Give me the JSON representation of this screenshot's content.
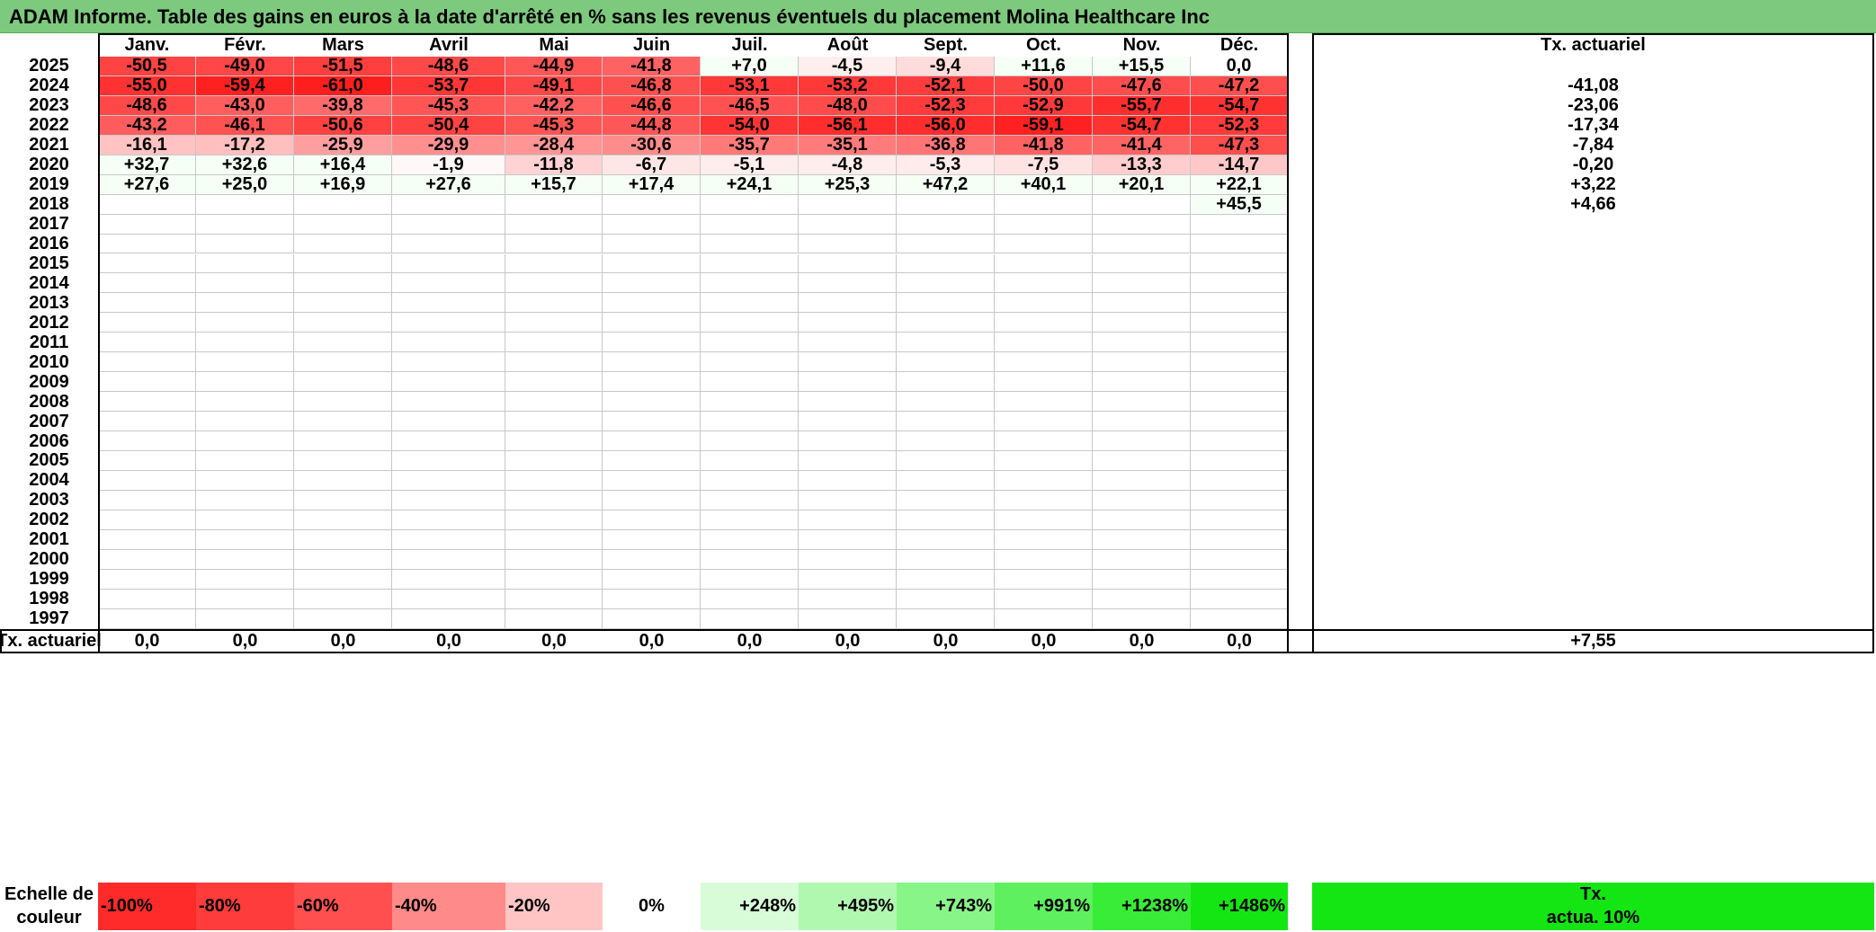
{
  "title": "ADAM Informe. Table des gains en euros à la date d'arrêté en % sans les revenus éventuels du placement Molina Healthcare Inc",
  "months": [
    "Janv.",
    "Févr.",
    "Mars",
    "Avril",
    "Mai",
    "Juin",
    "Juil.",
    "Août",
    "Sept.",
    "Oct.",
    "Nov.",
    "Déc."
  ],
  "annual_header": "Tx. actuariel",
  "rows": [
    {
      "year": "2025",
      "values": [
        "-50,5",
        "-49,0",
        "-51,5",
        "-48,6",
        "-44,9",
        "-41,8",
        "+7,0",
        "-4,5",
        "-9,4",
        "+11,6",
        "+15,5",
        "0,0"
      ],
      "annual": ""
    },
    {
      "year": "2024",
      "values": [
        "-55,0",
        "-59,4",
        "-61,0",
        "-53,7",
        "-49,1",
        "-46,8",
        "-53,1",
        "-53,2",
        "-52,1",
        "-50,0",
        "-47,6",
        "-47,2"
      ],
      "annual": "-41,08"
    },
    {
      "year": "2023",
      "values": [
        "-48,6",
        "-43,0",
        "-39,8",
        "-45,3",
        "-42,2",
        "-46,6",
        "-46,5",
        "-48,0",
        "-52,3",
        "-52,9",
        "-55,7",
        "-54,7"
      ],
      "annual": "-23,06"
    },
    {
      "year": "2022",
      "values": [
        "-43,2",
        "-46,1",
        "-50,6",
        "-50,4",
        "-45,3",
        "-44,8",
        "-54,0",
        "-56,1",
        "-56,0",
        "-59,1",
        "-54,7",
        "-52,3"
      ],
      "annual": "-17,34"
    },
    {
      "year": "2021",
      "values": [
        "-16,1",
        "-17,2",
        "-25,9",
        "-29,9",
        "-28,4",
        "-30,6",
        "-35,7",
        "-35,1",
        "-36,8",
        "-41,8",
        "-41,4",
        "-47,3"
      ],
      "annual": "-7,84"
    },
    {
      "year": "2020",
      "values": [
        "+32,7",
        "+32,6",
        "+16,4",
        "-1,9",
        "-11,8",
        "-6,7",
        "-5,1",
        "-4,8",
        "-5,3",
        "-7,5",
        "-13,3",
        "-14,7"
      ],
      "annual": "-0,20"
    },
    {
      "year": "2019",
      "values": [
        "+27,6",
        "+25,0",
        "+16,9",
        "+27,6",
        "+15,7",
        "+17,4",
        "+24,1",
        "+25,3",
        "+47,2",
        "+40,1",
        "+20,1",
        "+22,1"
      ],
      "annual": "+3,22"
    },
    {
      "year": "2018",
      "values": [
        "",
        "",
        "",
        "",
        "",
        "",
        "",
        "",
        "",
        "",
        "",
        "+45,5"
      ],
      "annual": "+4,66"
    },
    {
      "year": "2017",
      "values": [
        "",
        "",
        "",
        "",
        "",
        "",
        "",
        "",
        "",
        "",
        "",
        ""
      ],
      "annual": ""
    },
    {
      "year": "2016",
      "values": [
        "",
        "",
        "",
        "",
        "",
        "",
        "",
        "",
        "",
        "",
        "",
        ""
      ],
      "annual": ""
    },
    {
      "year": "2015",
      "values": [
        "",
        "",
        "",
        "",
        "",
        "",
        "",
        "",
        "",
        "",
        "",
        ""
      ],
      "annual": ""
    },
    {
      "year": "2014",
      "values": [
        "",
        "",
        "",
        "",
        "",
        "",
        "",
        "",
        "",
        "",
        "",
        ""
      ],
      "annual": ""
    },
    {
      "year": "2013",
      "values": [
        "",
        "",
        "",
        "",
        "",
        "",
        "",
        "",
        "",
        "",
        "",
        ""
      ],
      "annual": ""
    },
    {
      "year": "2012",
      "values": [
        "",
        "",
        "",
        "",
        "",
        "",
        "",
        "",
        "",
        "",
        "",
        ""
      ],
      "annual": ""
    },
    {
      "year": "2011",
      "values": [
        "",
        "",
        "",
        "",
        "",
        "",
        "",
        "",
        "",
        "",
        "",
        ""
      ],
      "annual": ""
    },
    {
      "year": "2010",
      "values": [
        "",
        "",
        "",
        "",
        "",
        "",
        "",
        "",
        "",
        "",
        "",
        ""
      ],
      "annual": ""
    },
    {
      "year": "2009",
      "values": [
        "",
        "",
        "",
        "",
        "",
        "",
        "",
        "",
        "",
        "",
        "",
        ""
      ],
      "annual": ""
    },
    {
      "year": "2008",
      "values": [
        "",
        "",
        "",
        "",
        "",
        "",
        "",
        "",
        "",
        "",
        "",
        ""
      ],
      "annual": ""
    },
    {
      "year": "2007",
      "values": [
        "",
        "",
        "",
        "",
        "",
        "",
        "",
        "",
        "",
        "",
        "",
        ""
      ],
      "annual": ""
    },
    {
      "year": "2006",
      "values": [
        "",
        "",
        "",
        "",
        "",
        "",
        "",
        "",
        "",
        "",
        "",
        ""
      ],
      "annual": ""
    },
    {
      "year": "2005",
      "values": [
        "",
        "",
        "",
        "",
        "",
        "",
        "",
        "",
        "",
        "",
        "",
        ""
      ],
      "annual": ""
    },
    {
      "year": "2004",
      "values": [
        "",
        "",
        "",
        "",
        "",
        "",
        "",
        "",
        "",
        "",
        "",
        ""
      ],
      "annual": ""
    },
    {
      "year": "2003",
      "values": [
        "",
        "",
        "",
        "",
        "",
        "",
        "",
        "",
        "",
        "",
        "",
        ""
      ],
      "annual": ""
    },
    {
      "year": "2002",
      "values": [
        "",
        "",
        "",
        "",
        "",
        "",
        "",
        "",
        "",
        "",
        "",
        ""
      ],
      "annual": ""
    },
    {
      "year": "2001",
      "values": [
        "",
        "",
        "",
        "",
        "",
        "",
        "",
        "",
        "",
        "",
        "",
        ""
      ],
      "annual": ""
    },
    {
      "year": "2000",
      "values": [
        "",
        "",
        "",
        "",
        "",
        "",
        "",
        "",
        "",
        "",
        "",
        ""
      ],
      "annual": ""
    },
    {
      "year": "1999",
      "values": [
        "",
        "",
        "",
        "",
        "",
        "",
        "",
        "",
        "",
        "",
        "",
        ""
      ],
      "annual": ""
    },
    {
      "year": "1998",
      "values": [
        "",
        "",
        "",
        "",
        "",
        "",
        "",
        "",
        "",
        "",
        "",
        ""
      ],
      "annual": ""
    },
    {
      "year": "1997",
      "values": [
        "",
        "",
        "",
        "",
        "",
        "",
        "",
        "",
        "",
        "",
        "",
        ""
      ],
      "annual": ""
    }
  ],
  "footer": {
    "label": "Tx. actuariel",
    "values": [
      "0,0",
      "0,0",
      "0,0",
      "0,0",
      "0,0",
      "0,0",
      "0,0",
      "0,0",
      "0,0",
      "0,0",
      "0,0",
      "0,0"
    ],
    "annual": "+7,55"
  },
  "scale": {
    "label_line1": "Echelle de",
    "label_line2": "couleur",
    "items": [
      {
        "text": "-100%",
        "color": "#ff2a2a"
      },
      {
        "text": "-80%",
        "color": "#ff3c3c"
      },
      {
        "text": "-60%",
        "color": "#ff4f4f"
      },
      {
        "text": "-40%",
        "color": "#ff8a8a"
      },
      {
        "text": "-20%",
        "color": "#ffc4c4"
      },
      {
        "text": "0%",
        "color": "#ffffff"
      },
      {
        "text": "+248%",
        "color": "#d8fcd8"
      },
      {
        "text": "+495%",
        "color": "#b0f8b0"
      },
      {
        "text": "+743%",
        "color": "#88f588"
      },
      {
        "text": "+991%",
        "color": "#5ef05e"
      },
      {
        "text": "+1238%",
        "color": "#38ec38"
      },
      {
        "text": "+1486%",
        "color": "#14e614"
      }
    ],
    "target_line1": "Tx.",
    "target_line2": "actua. 10%",
    "target_color": "#14e614"
  }
}
